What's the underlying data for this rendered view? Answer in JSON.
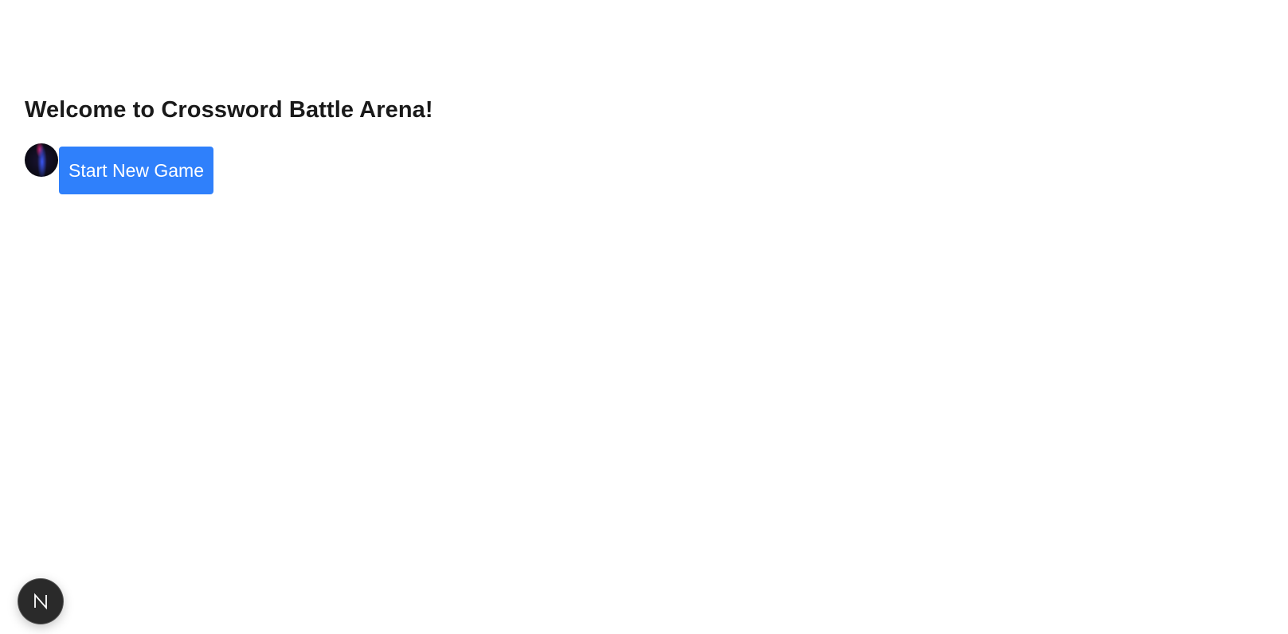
{
  "main": {
    "title": "Welcome to Crossword Battle Arena!",
    "start_button_label": "Start New Game"
  },
  "dev_indicator": {
    "icon": "nextjs-logo-icon"
  },
  "colors": {
    "button_bg": "#2f80fb",
    "button_text": "#ffffff",
    "badge_bg": "#2a2a2a"
  }
}
